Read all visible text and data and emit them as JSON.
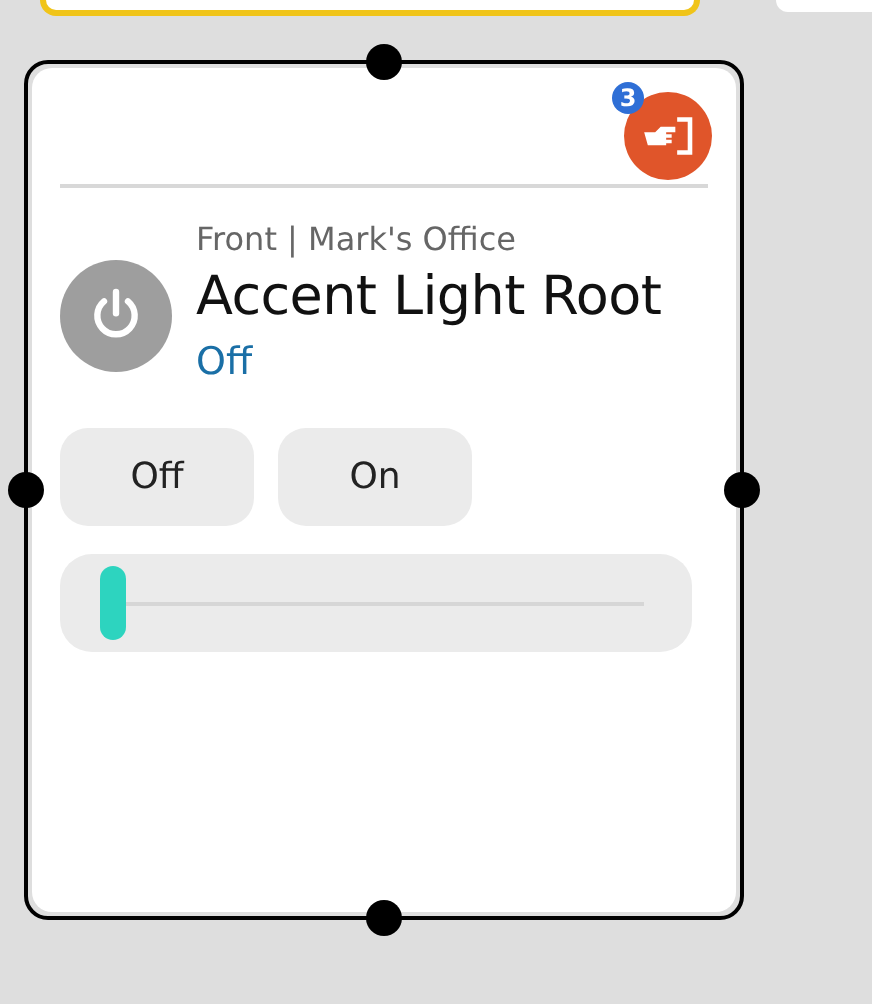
{
  "device": {
    "location": "Front | Mark's Office",
    "name": "Accent Light Root",
    "status": "Off"
  },
  "action_badge": {
    "count": "3"
  },
  "buttons": [
    {
      "label": "Off"
    },
    {
      "label": "On"
    }
  ],
  "slider": {
    "level": 0
  }
}
